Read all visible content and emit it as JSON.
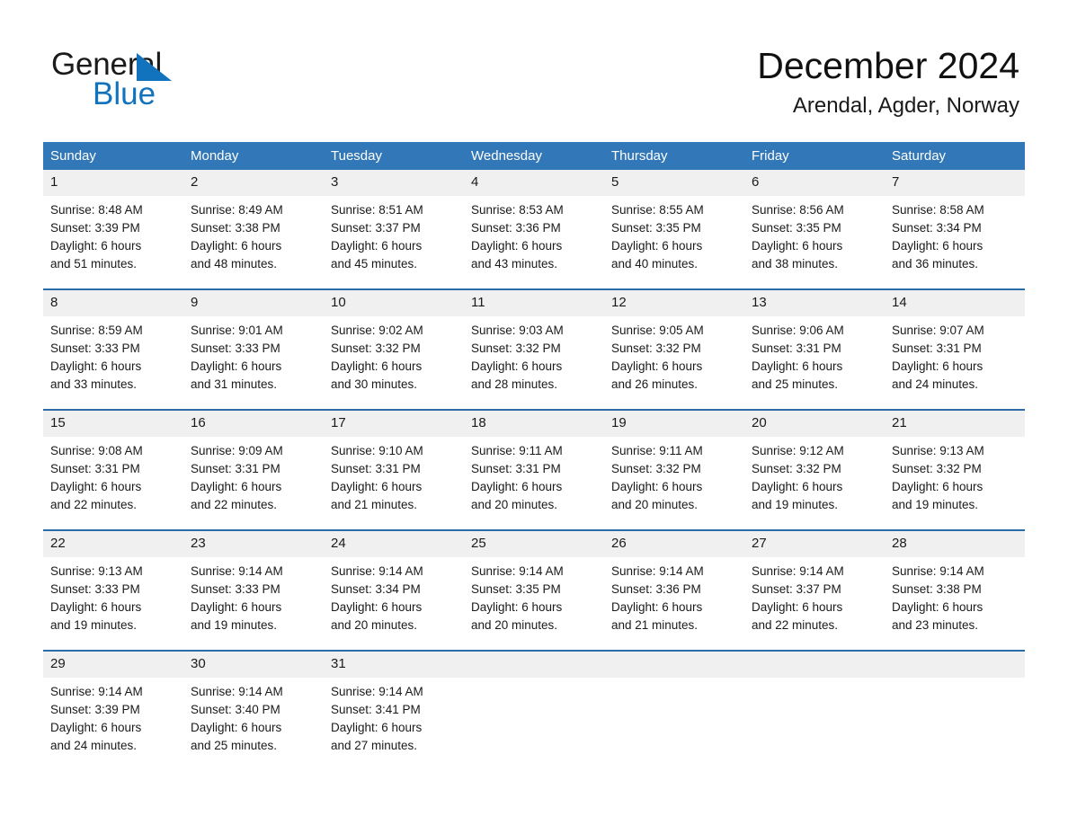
{
  "brand": {
    "name_part1": "General",
    "name_part2": "Blue",
    "triangle_color": "#1173bd",
    "text_color": "#1a1a1a"
  },
  "header": {
    "title": "December 2024",
    "subtitle": "Arendal, Agder, Norway"
  },
  "colors": {
    "header_blue": "#3277b7",
    "row_rule_blue": "#2b6ca8",
    "daynum_band": "#f0f0f0",
    "text": "#1a1a1a"
  },
  "weekday_headers": [
    "Sunday",
    "Monday",
    "Tuesday",
    "Wednesday",
    "Thursday",
    "Friday",
    "Saturday"
  ],
  "weeks": [
    [
      {
        "day": "1",
        "sunrise": "Sunrise: 8:48 AM",
        "sunset": "Sunset: 3:39 PM",
        "daylight_1": "Daylight: 6 hours",
        "daylight_2": "and 51 minutes."
      },
      {
        "day": "2",
        "sunrise": "Sunrise: 8:49 AM",
        "sunset": "Sunset: 3:38 PM",
        "daylight_1": "Daylight: 6 hours",
        "daylight_2": "and 48 minutes."
      },
      {
        "day": "3",
        "sunrise": "Sunrise: 8:51 AM",
        "sunset": "Sunset: 3:37 PM",
        "daylight_1": "Daylight: 6 hours",
        "daylight_2": "and 45 minutes."
      },
      {
        "day": "4",
        "sunrise": "Sunrise: 8:53 AM",
        "sunset": "Sunset: 3:36 PM",
        "daylight_1": "Daylight: 6 hours",
        "daylight_2": "and 43 minutes."
      },
      {
        "day": "5",
        "sunrise": "Sunrise: 8:55 AM",
        "sunset": "Sunset: 3:35 PM",
        "daylight_1": "Daylight: 6 hours",
        "daylight_2": "and 40 minutes."
      },
      {
        "day": "6",
        "sunrise": "Sunrise: 8:56 AM",
        "sunset": "Sunset: 3:35 PM",
        "daylight_1": "Daylight: 6 hours",
        "daylight_2": "and 38 minutes."
      },
      {
        "day": "7",
        "sunrise": "Sunrise: 8:58 AM",
        "sunset": "Sunset: 3:34 PM",
        "daylight_1": "Daylight: 6 hours",
        "daylight_2": "and 36 minutes."
      }
    ],
    [
      {
        "day": "8",
        "sunrise": "Sunrise: 8:59 AM",
        "sunset": "Sunset: 3:33 PM",
        "daylight_1": "Daylight: 6 hours",
        "daylight_2": "and 33 minutes."
      },
      {
        "day": "9",
        "sunrise": "Sunrise: 9:01 AM",
        "sunset": "Sunset: 3:33 PM",
        "daylight_1": "Daylight: 6 hours",
        "daylight_2": "and 31 minutes."
      },
      {
        "day": "10",
        "sunrise": "Sunrise: 9:02 AM",
        "sunset": "Sunset: 3:32 PM",
        "daylight_1": "Daylight: 6 hours",
        "daylight_2": "and 30 minutes."
      },
      {
        "day": "11",
        "sunrise": "Sunrise: 9:03 AM",
        "sunset": "Sunset: 3:32 PM",
        "daylight_1": "Daylight: 6 hours",
        "daylight_2": "and 28 minutes."
      },
      {
        "day": "12",
        "sunrise": "Sunrise: 9:05 AM",
        "sunset": "Sunset: 3:32 PM",
        "daylight_1": "Daylight: 6 hours",
        "daylight_2": "and 26 minutes."
      },
      {
        "day": "13",
        "sunrise": "Sunrise: 9:06 AM",
        "sunset": "Sunset: 3:31 PM",
        "daylight_1": "Daylight: 6 hours",
        "daylight_2": "and 25 minutes."
      },
      {
        "day": "14",
        "sunrise": "Sunrise: 9:07 AM",
        "sunset": "Sunset: 3:31 PM",
        "daylight_1": "Daylight: 6 hours",
        "daylight_2": "and 24 minutes."
      }
    ],
    [
      {
        "day": "15",
        "sunrise": "Sunrise: 9:08 AM",
        "sunset": "Sunset: 3:31 PM",
        "daylight_1": "Daylight: 6 hours",
        "daylight_2": "and 22 minutes."
      },
      {
        "day": "16",
        "sunrise": "Sunrise: 9:09 AM",
        "sunset": "Sunset: 3:31 PM",
        "daylight_1": "Daylight: 6 hours",
        "daylight_2": "and 22 minutes."
      },
      {
        "day": "17",
        "sunrise": "Sunrise: 9:10 AM",
        "sunset": "Sunset: 3:31 PM",
        "daylight_1": "Daylight: 6 hours",
        "daylight_2": "and 21 minutes."
      },
      {
        "day": "18",
        "sunrise": "Sunrise: 9:11 AM",
        "sunset": "Sunset: 3:31 PM",
        "daylight_1": "Daylight: 6 hours",
        "daylight_2": "and 20 minutes."
      },
      {
        "day": "19",
        "sunrise": "Sunrise: 9:11 AM",
        "sunset": "Sunset: 3:32 PM",
        "daylight_1": "Daylight: 6 hours",
        "daylight_2": "and 20 minutes."
      },
      {
        "day": "20",
        "sunrise": "Sunrise: 9:12 AM",
        "sunset": "Sunset: 3:32 PM",
        "daylight_1": "Daylight: 6 hours",
        "daylight_2": "and 19 minutes."
      },
      {
        "day": "21",
        "sunrise": "Sunrise: 9:13 AM",
        "sunset": "Sunset: 3:32 PM",
        "daylight_1": "Daylight: 6 hours",
        "daylight_2": "and 19 minutes."
      }
    ],
    [
      {
        "day": "22",
        "sunrise": "Sunrise: 9:13 AM",
        "sunset": "Sunset: 3:33 PM",
        "daylight_1": "Daylight: 6 hours",
        "daylight_2": "and 19 minutes."
      },
      {
        "day": "23",
        "sunrise": "Sunrise: 9:14 AM",
        "sunset": "Sunset: 3:33 PM",
        "daylight_1": "Daylight: 6 hours",
        "daylight_2": "and 19 minutes."
      },
      {
        "day": "24",
        "sunrise": "Sunrise: 9:14 AM",
        "sunset": "Sunset: 3:34 PM",
        "daylight_1": "Daylight: 6 hours",
        "daylight_2": "and 20 minutes."
      },
      {
        "day": "25",
        "sunrise": "Sunrise: 9:14 AM",
        "sunset": "Sunset: 3:35 PM",
        "daylight_1": "Daylight: 6 hours",
        "daylight_2": "and 20 minutes."
      },
      {
        "day": "26",
        "sunrise": "Sunrise: 9:14 AM",
        "sunset": "Sunset: 3:36 PM",
        "daylight_1": "Daylight: 6 hours",
        "daylight_2": "and 21 minutes."
      },
      {
        "day": "27",
        "sunrise": "Sunrise: 9:14 AM",
        "sunset": "Sunset: 3:37 PM",
        "daylight_1": "Daylight: 6 hours",
        "daylight_2": "and 22 minutes."
      },
      {
        "day": "28",
        "sunrise": "Sunrise: 9:14 AM",
        "sunset": "Sunset: 3:38 PM",
        "daylight_1": "Daylight: 6 hours",
        "daylight_2": "and 23 minutes."
      }
    ],
    [
      {
        "day": "29",
        "sunrise": "Sunrise: 9:14 AM",
        "sunset": "Sunset: 3:39 PM",
        "daylight_1": "Daylight: 6 hours",
        "daylight_2": "and 24 minutes."
      },
      {
        "day": "30",
        "sunrise": "Sunrise: 9:14 AM",
        "sunset": "Sunset: 3:40 PM",
        "daylight_1": "Daylight: 6 hours",
        "daylight_2": "and 25 minutes."
      },
      {
        "day": "31",
        "sunrise": "Sunrise: 9:14 AM",
        "sunset": "Sunset: 3:41 PM",
        "daylight_1": "Daylight: 6 hours",
        "daylight_2": "and 27 minutes."
      },
      {
        "day": "",
        "sunrise": "",
        "sunset": "",
        "daylight_1": "",
        "daylight_2": "",
        "empty": true
      },
      {
        "day": "",
        "sunrise": "",
        "sunset": "",
        "daylight_1": "",
        "daylight_2": "",
        "empty": true
      },
      {
        "day": "",
        "sunrise": "",
        "sunset": "",
        "daylight_1": "",
        "daylight_2": "",
        "empty": true
      },
      {
        "day": "",
        "sunrise": "",
        "sunset": "",
        "daylight_1": "",
        "daylight_2": "",
        "empty": true
      }
    ]
  ]
}
